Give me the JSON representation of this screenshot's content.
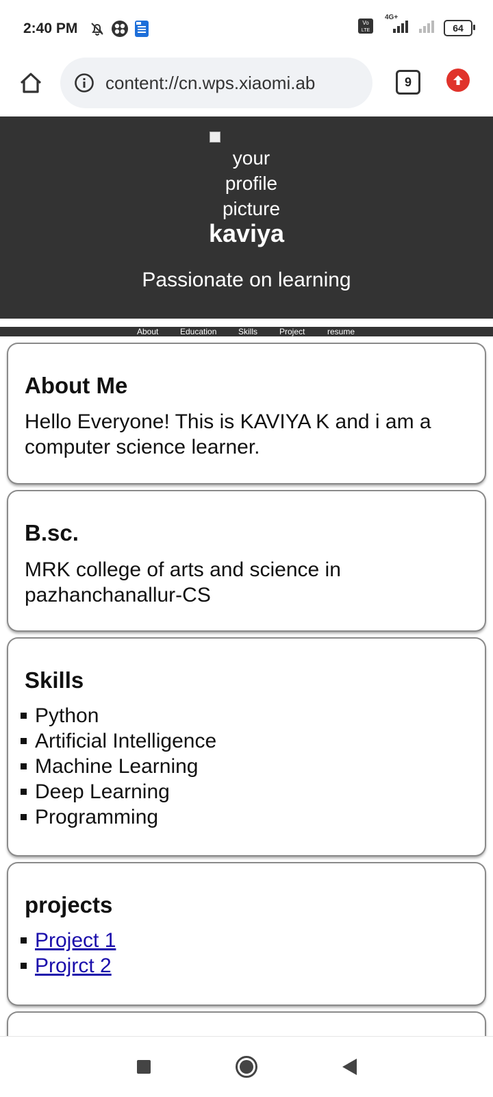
{
  "status_bar": {
    "time": "2:40 PM",
    "network_label": "4G+",
    "volte_label": "Vo LTE",
    "battery": "64",
    "icons": [
      "bell-off-icon",
      "app-icon",
      "docs-icon",
      "volte-icon",
      "signal-icon",
      "signal-weak-icon",
      "battery-icon"
    ]
  },
  "browser": {
    "url": "content://cn.wps.xiaomi.ab",
    "tab_count": "9",
    "icons": [
      "home-icon",
      "info-icon",
      "tabs-icon",
      "upload-icon"
    ]
  },
  "header": {
    "profile_alt_lines": [
      "your",
      "profile",
      "picture"
    ],
    "name": "kaviya",
    "tagline": "Passionate on learning",
    "colors": {
      "header_bg": "#333333",
      "text": "#ffffff"
    }
  },
  "nav": {
    "items": [
      "About",
      "Education",
      "Skills",
      "Project",
      "resume"
    ]
  },
  "sections": {
    "about": {
      "title": "About Me",
      "text": "Hello Everyone! This is KAVIYA K and i am a computer science learner."
    },
    "education": {
      "title": "B.sc.",
      "text": "MRK college of arts and science in pazhanchanallur-CS"
    },
    "skills": {
      "title": "Skills",
      "items": [
        "Python",
        "Artificial Intelligence",
        "Machine Learning",
        "Deep Learning",
        "Programming"
      ]
    },
    "projects": {
      "title": "projects",
      "items": [
        "Project 1",
        "Projrct 2"
      ],
      "link_color": "#1a0dab"
    }
  },
  "system_nav": {
    "icons": [
      "recents-icon",
      "home-circle-icon",
      "back-icon"
    ]
  }
}
